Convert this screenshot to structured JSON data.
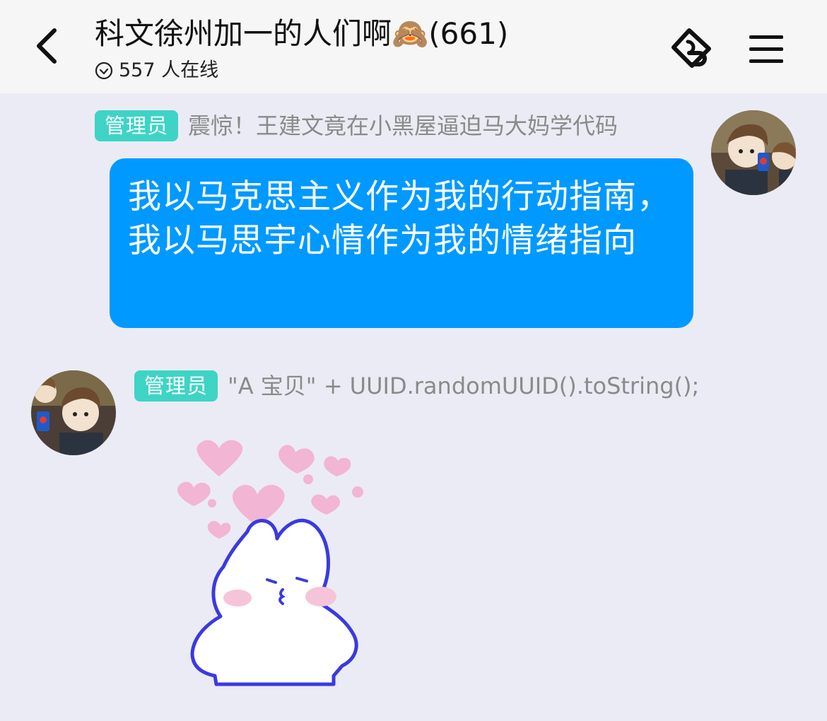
{
  "header": {
    "title": "科文徐州加一的人们啊🙈(661)",
    "online_text": "557 人在线",
    "icons": {
      "back": "chevron-left-icon",
      "online": "clock-check-icon",
      "tag": "tag-link-icon",
      "menu": "menu-icon"
    }
  },
  "messages": [
    {
      "side": "right",
      "badge": "管理员",
      "nickname": "震惊！王建文竟在小黑屋逼迫马大妈学代码",
      "text": "我以马克思主义作为我的行动指南，我以马思宇心情作为我的情绪指向",
      "bubble_color": "#0099FF"
    },
    {
      "side": "left",
      "badge": "管理员",
      "nickname": "\"A 宝贝\" + UUID.randomUUID().toString();",
      "sticker": "bunny-hearts-sticker"
    }
  ],
  "colors": {
    "background": "#EBEBF5",
    "header_bg": "#F6F6F6",
    "badge_bg": "#3ED4C5",
    "bubble": "#0099FF"
  }
}
